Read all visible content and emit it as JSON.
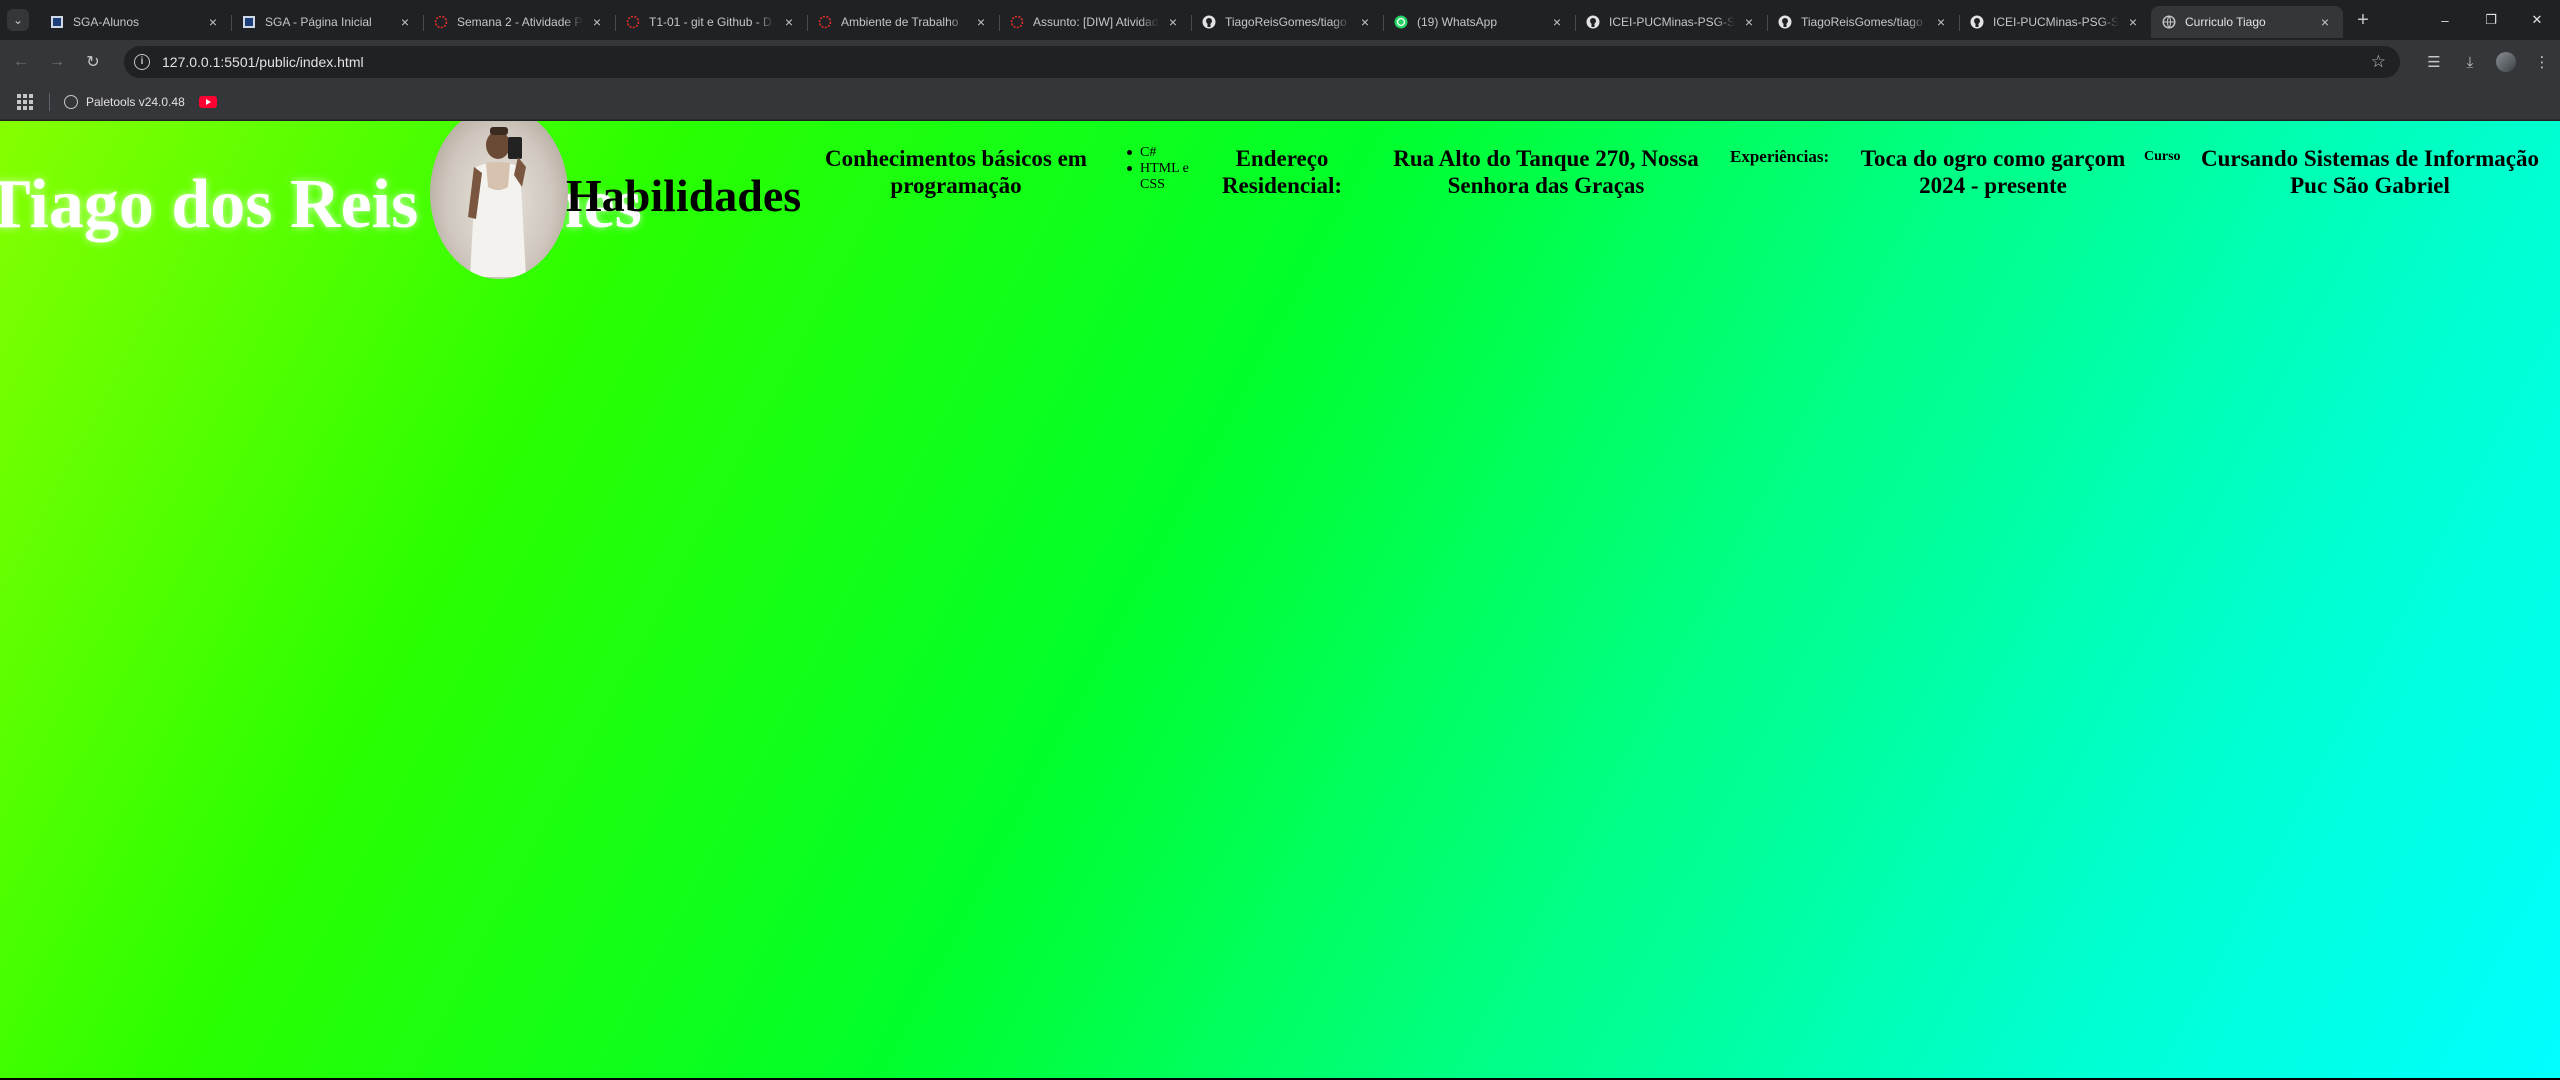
{
  "browser": {
    "tabs": [
      {
        "title": "SGA-Alunos",
        "icon": "sga-icon",
        "active": false
      },
      {
        "title": "SGA - Página Inicial",
        "icon": "sga-icon",
        "active": false
      },
      {
        "title": "Semana 2 - Atividade P",
        "icon": "canvas-icon",
        "active": false
      },
      {
        "title": "T1-01 - git e Github - D",
        "icon": "canvas-icon",
        "active": false
      },
      {
        "title": "Ambiente de Trabalho",
        "icon": "canvas-icon",
        "active": false
      },
      {
        "title": "Assunto: [DIW] Atividad",
        "icon": "canvas-icon",
        "active": false
      },
      {
        "title": "TiagoReisGomes/tiago",
        "icon": "github-icon",
        "active": false
      },
      {
        "title": "(19) WhatsApp",
        "icon": "whatsapp-icon",
        "active": false
      },
      {
        "title": "ICEI-PUCMinas-PSG-SI",
        "icon": "github-icon",
        "active": false
      },
      {
        "title": "TiagoReisGomes/tiago",
        "icon": "github-icon",
        "active": false
      },
      {
        "title": "ICEI-PUCMinas-PSG-SI",
        "icon": "github-icon",
        "active": false
      },
      {
        "title": "Curriculo Tiago",
        "icon": "globe-icon",
        "active": true
      }
    ],
    "url": "127.0.0.1:5501/public/index.html",
    "bookmarks": [
      {
        "label": "Paletools v24.0.48",
        "icon": "globe-icon"
      }
    ]
  },
  "page": {
    "name": "Tiago dos Reis Gomes",
    "heading_skills": "Habilidades",
    "skills_title": "Conhecimentos básicos em programação",
    "skills": [
      "C#",
      "HTML e CSS"
    ],
    "address_label": "Endereço Residencial:",
    "address_value": "Rua Alto do Tanque 270, Nossa Senhora das Graças",
    "experience_label": "Experiências:",
    "experience_value": "Toca do ogro como garçom 2024 - presente",
    "course_label": "Curso",
    "course_value_line1": "Cursando Sistemas de Informação",
    "course_value_line2": "Puc São Gabriel"
  }
}
